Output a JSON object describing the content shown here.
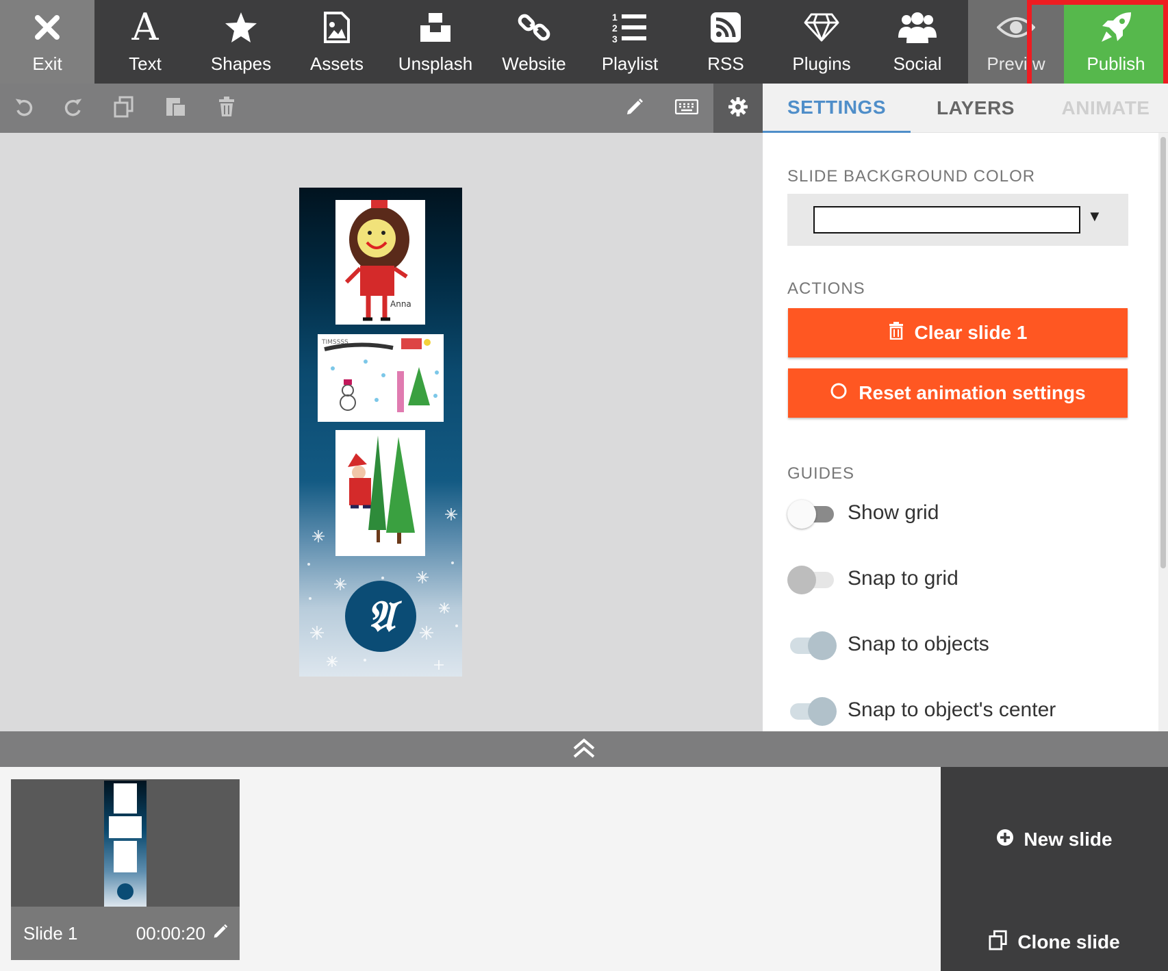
{
  "toolbar": {
    "items": [
      {
        "label": "Exit",
        "icon": "close-icon"
      },
      {
        "label": "Text",
        "icon": "text-icon"
      },
      {
        "label": "Shapes",
        "icon": "star-icon"
      },
      {
        "label": "Assets",
        "icon": "image-icon"
      },
      {
        "label": "Unsplash",
        "icon": "unsplash-icon"
      },
      {
        "label": "Website",
        "icon": "link-icon"
      },
      {
        "label": "Playlist",
        "icon": "list-icon"
      },
      {
        "label": "RSS",
        "icon": "rss-icon"
      },
      {
        "label": "Plugins",
        "icon": "diamond-icon"
      },
      {
        "label": "Social",
        "icon": "users-icon"
      },
      {
        "label": "Previ w",
        "icon": "eye-icon"
      },
      {
        "label": "Publish",
        "icon": "rocket-icon"
      }
    ],
    "highlight_color": "#ee1c22",
    "publish_color": "#56b84c"
  },
  "edit_toolbar": {
    "icons": [
      "undo-icon",
      "redo-icon",
      "copy-icon",
      "paste-icon",
      "trash-icon",
      "pencil-icon",
      "keyboard-icon",
      "gear-icon"
    ]
  },
  "canvas": {
    "slide_logo_text": "𝔄"
  },
  "panel": {
    "tabs": [
      "SETTINGS",
      "LAYERS",
      "ANIMATE"
    ],
    "active_tab": "SETTINGS",
    "bg_color_label": "SLIDE BACKGROUND COLOR",
    "bg_color_value": "#ffffff",
    "actions_label": "ACTIONS",
    "clear_label": "Clear slide 1",
    "reset_label": "Reset animation settings",
    "action_color": "#ff5722",
    "guides_label": "GUIDES",
    "guides": [
      {
        "label": "Show grid",
        "state": "off"
      },
      {
        "label": "Snap to grid",
        "state": "off-disabled"
      },
      {
        "label": "Snap to objects",
        "state": "on-disabled"
      },
      {
        "label": "Snap to object's center",
        "state": "on-disabled"
      }
    ]
  },
  "slides": [
    {
      "title": "Slide 1",
      "duration": "00:00:20"
    }
  ],
  "slide_actions": {
    "new_slide": "New slide",
    "clone_slide": "Clone slide"
  }
}
